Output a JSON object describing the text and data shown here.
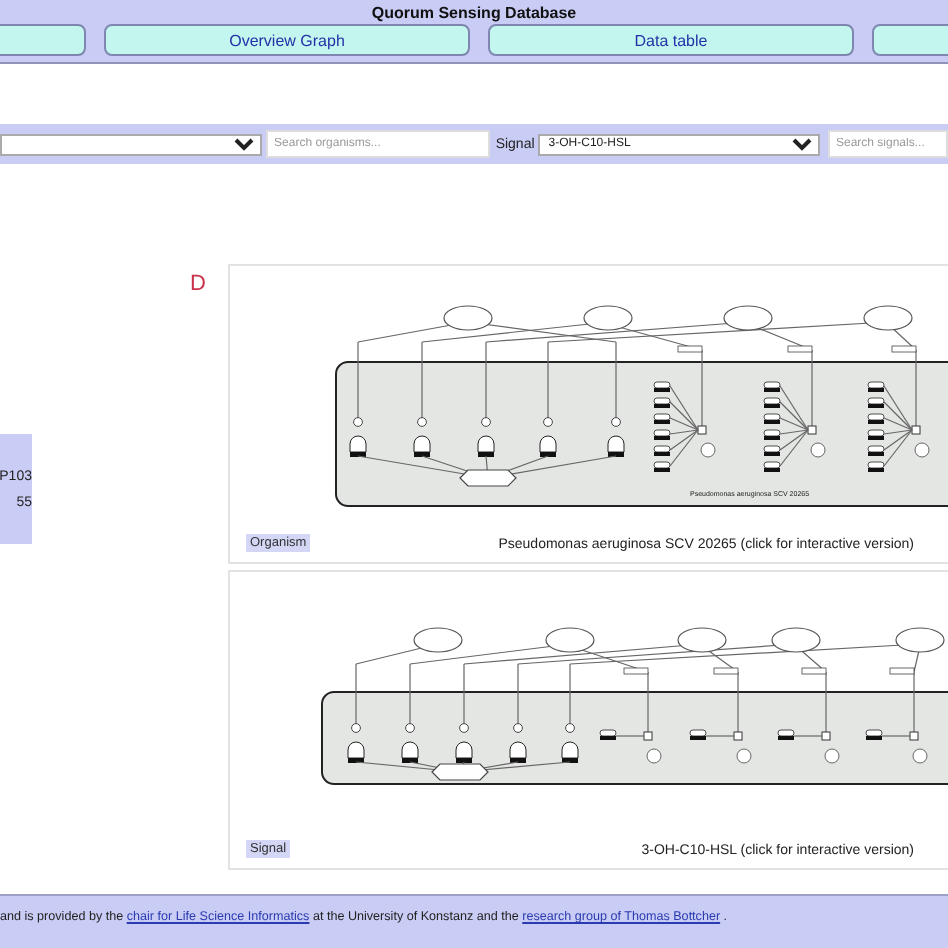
{
  "header": {
    "title": "Quorum Sensing Database",
    "nav": [
      {
        "label": "Overview Graph"
      },
      {
        "label": "Data table"
      }
    ]
  },
  "filters": {
    "organism_search": {
      "placeholder": "Search organisms..."
    },
    "signal_label": "Signal",
    "signal_select": {
      "value": "3-OH-C10-HSL"
    },
    "signal_search": {
      "placeholder": "Search signals..."
    }
  },
  "side_panel": {
    "lines": [
      "P103",
      "55"
    ]
  },
  "panel_letter": "D",
  "cards": [
    {
      "kind": "organism-network",
      "diagram_label": "Pseudomonas aeruginosa SCV 20265",
      "tag": "Organism",
      "caption": "Pseudomonas aeruginosa SCV 20265 (click for interactive version)"
    },
    {
      "kind": "signal-network",
      "tag": "Signal",
      "caption": "3-OH-C10-HSL (click for interactive version)"
    }
  ],
  "footer": {
    "parts": [
      {
        "text": "and is provided by the ",
        "link": false
      },
      {
        "text": "chair for Life Science Informatics",
        "link": true
      },
      {
        "text": " at the University of Konstanz and the ",
        "link": false
      },
      {
        "text": "research group of Thomas Bottcher",
        "link": true
      },
      {
        "text": " .",
        "link": false
      }
    ]
  }
}
